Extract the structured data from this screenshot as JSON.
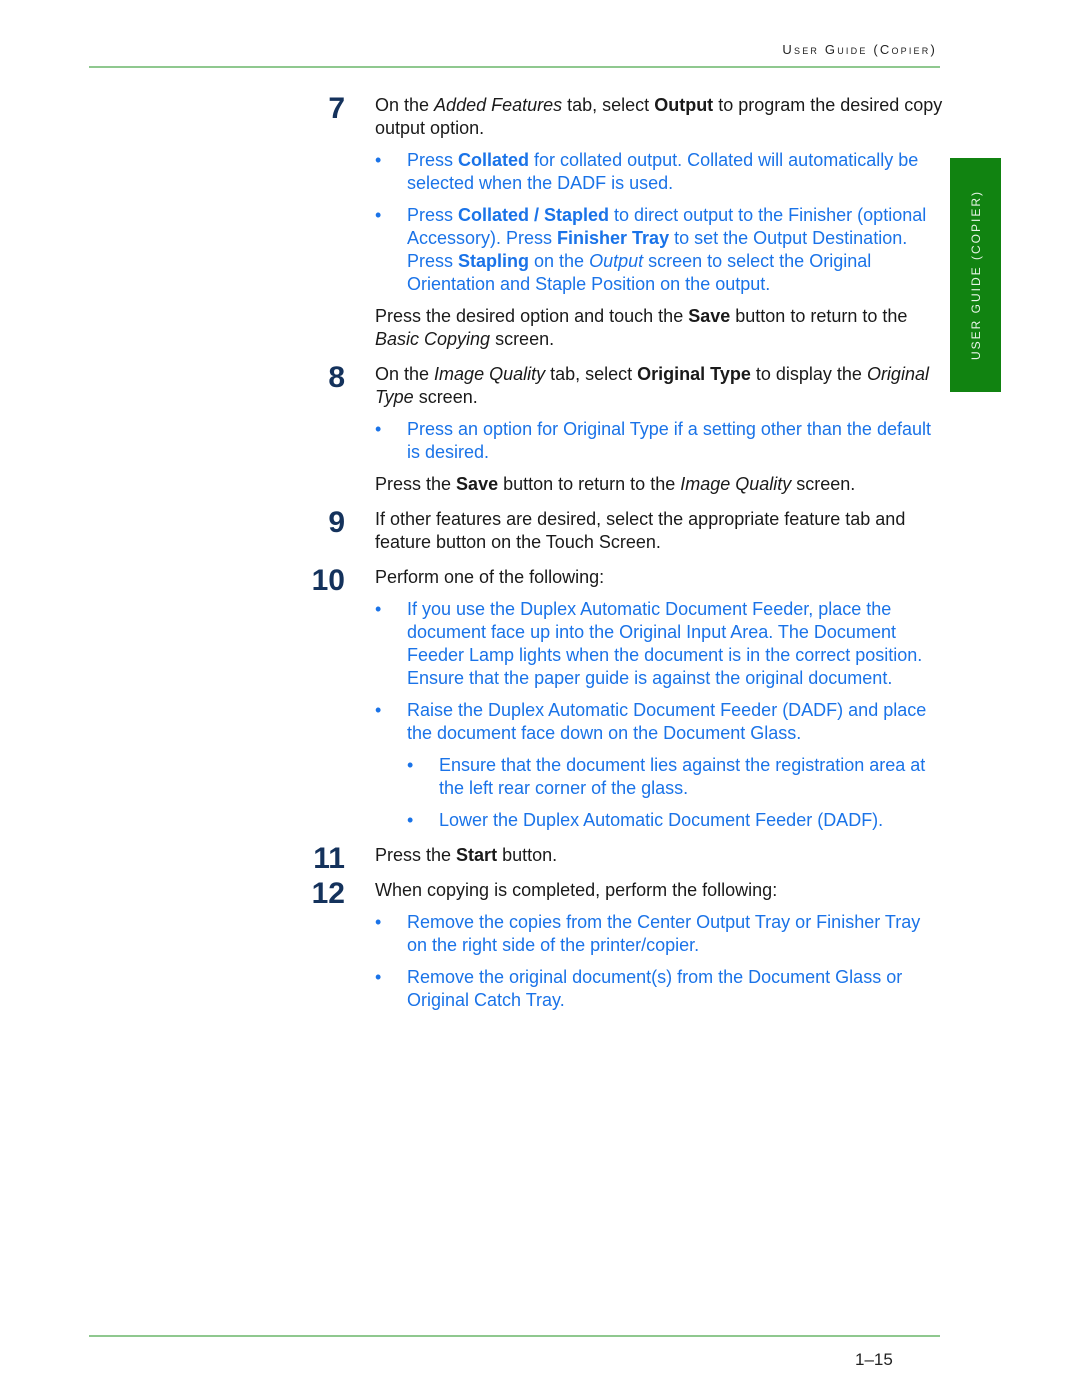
{
  "header": {
    "title": "User Guide (Copier)",
    "side_tab": "USER GUIDE (COPIER)"
  },
  "footer": {
    "page_number": "1–15"
  },
  "steps": [
    {
      "number": "7",
      "intro": [
        "On the ",
        {
          "i": "Added Features"
        },
        " tab, select ",
        {
          "b": "Output"
        },
        " to program the desired copy output option."
      ],
      "bullets": [
        [
          "Press ",
          {
            "b": "Collated"
          },
          " for collated output.  Collated will automatically be selected when the DADF is used."
        ],
        [
          "Press ",
          {
            "b": "Collated / Stapled"
          },
          " to direct output to the Finisher (optional Accessory).  Press ",
          {
            "b": "Finisher Tray"
          },
          " to set the Output Destination.  Press ",
          {
            "b": "Stapling"
          },
          " on the ",
          {
            "i": "Output"
          },
          " screen to select the Original Orientation and Staple Position on the output."
        ]
      ],
      "outro": [
        "Press the desired option and touch the ",
        {
          "b": "Save"
        },
        " button to return to the ",
        {
          "i": "Basic Copying"
        },
        " screen."
      ]
    },
    {
      "number": "8",
      "intro": [
        "On the ",
        {
          "i": "Image Quality"
        },
        " tab, select ",
        {
          "b": "Original Type"
        },
        " to display the ",
        {
          "i": "Original Type"
        },
        " screen."
      ],
      "bullets": [
        [
          "Press an option for Original Type if a setting other than the default is desired."
        ]
      ],
      "outro": [
        "Press the ",
        {
          "b": "Save"
        },
        " button to return to the ",
        {
          "i": "Image Quality"
        },
        " screen."
      ]
    },
    {
      "number": "9",
      "intro": [
        "If other features are desired, select the appropriate feature tab and feature button on the Touch Screen."
      ]
    },
    {
      "number": "10",
      "intro": [
        "Perform one of the following:"
      ],
      "bullets": [
        [
          "If you use the Duplex Automatic Document Feeder, place the document face up into the Original Input Area.  The Document Feeder Lamp lights when the document is in the correct position.  Ensure that the paper guide is against the original document."
        ],
        [
          "Raise the Duplex Automatic Document Feeder (DADF) and place the document face down on the Document Glass."
        ]
      ],
      "sub_bullets": [
        [
          "Ensure that the document lies against the registration area at the left rear corner of the glass."
        ],
        [
          "Lower the Duplex Automatic Document Feeder (DADF)."
        ]
      ]
    },
    {
      "number": "11",
      "intro": [
        "Press the ",
        {
          "b": "Start"
        },
        " button."
      ]
    },
    {
      "number": "12",
      "intro": [
        "When copying is completed, perform the following:"
      ],
      "bullets": [
        [
          "Remove the copies from the Center Output Tray or Finisher Tray on the right side of the printer/copier."
        ],
        [
          "Remove the original document(s) from the Document Glass or Original Catch Tray."
        ]
      ]
    }
  ]
}
